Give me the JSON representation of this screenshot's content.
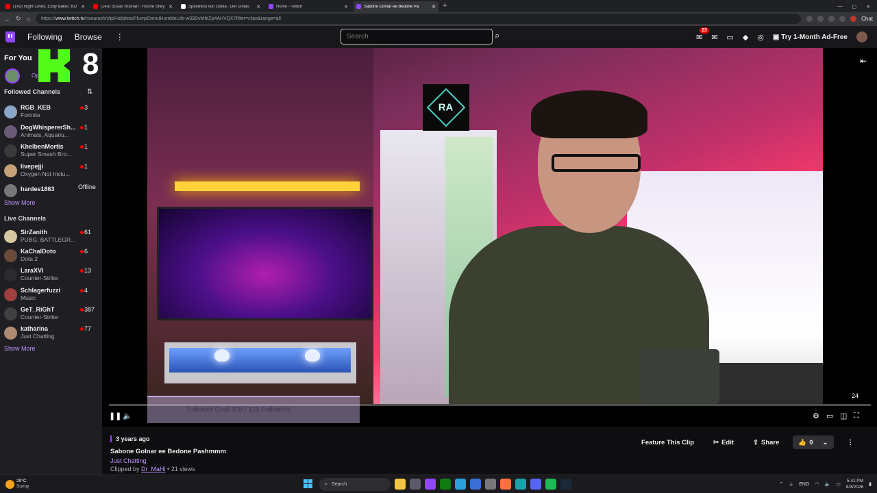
{
  "browser": {
    "tabs": [
      {
        "title": "(143) Night Lovell, Eddy Baker, BO",
        "favcolor": "#ff0000",
        "active": false
      },
      {
        "title": "(143) Susan Roshan - Roohe Shey",
        "favcolor": "#ff0000",
        "active": false
      },
      {
        "title": "Speedtest von Ookla - Der umfas",
        "favcolor": "#ffffff",
        "active": false
      },
      {
        "title": "Home - Twitch",
        "favcolor": "#9147ff",
        "active": false
      },
      {
        "title": "Sabone Golnar ee Bedone Pa",
        "favcolor": "#9147ff",
        "active": true
      }
    ],
    "url_prefix": "https://",
    "url_host": "www.twitch.tv",
    "url_path": "/risearash/clip/HelplessPlumpDonutHumbleLife-w39DvMfeZp4AHVQK?filter=clips&range=all",
    "chat_label": "Chat"
  },
  "topnav": {
    "following": "Following",
    "browse": "Browse",
    "search_placeholder": "Search",
    "notif_count": "23",
    "adfree": "Try 1-Month Ad-Free"
  },
  "sidebar": {
    "for_you": "For You",
    "for_you_sub": "Op",
    "overlay_number": "8",
    "followed_heading": "Followed Channels",
    "followed": [
      {
        "name": "RGB_KEB",
        "game": "Fortnite",
        "viewers": "3",
        "color": "#8aa6c8"
      },
      {
        "name": "DogWhispererSh...",
        "game": "Animals, Aquariu...",
        "viewers": "1",
        "color": "#6a5a7a"
      },
      {
        "name": "KhelbenMortis",
        "game": "Super Smash Bro...",
        "viewers": "1",
        "color": "#3a3a3a"
      },
      {
        "name": "livepejji",
        "game": "Oxygen Not Inclu...",
        "viewers": "1",
        "color": "#c8a078"
      }
    ],
    "offline_channel": {
      "name": "hardee1863",
      "status": "Offline",
      "color": "#777"
    },
    "show_more": "Show More",
    "live_heading": "Live Channels",
    "live": [
      {
        "name": "SirZanith",
        "game": "PUBG: BATTLEGR...",
        "viewers": "61",
        "color": "#d8c8a0"
      },
      {
        "name": "KaChalDoto",
        "game": "Dota 2",
        "viewers": "6",
        "color": "#6b4a3a"
      },
      {
        "name": "LaraXVI",
        "game": "Counter-Strike",
        "viewers": "13",
        "color": "#2a2a30"
      },
      {
        "name": "Schlagerfuzzi",
        "game": "Music",
        "viewers": "4",
        "color": "#a04040"
      },
      {
        "name": "GeT_RiGhT",
        "game": "Counter-Strike",
        "viewers": "387",
        "color": "#404040"
      },
      {
        "name": "katharina",
        "game": "Just Chatting",
        "viewers": "77",
        "color": "#b08a70"
      }
    ],
    "show_more_live": "Show More"
  },
  "player": {
    "logo_text": "RA",
    "overlay_text": "Follower Goal          108 / 110 Followers",
    "time_remaining": "24",
    "progress": 0.0
  },
  "clip": {
    "age": "3 years ago",
    "title": "Sabone Golnar ee Bedone Pashmmm",
    "category": "Just Chatting",
    "clipped_by_label": "Clipped by ",
    "clipper": "Dr_MaHi",
    "views": " • 21 views",
    "feature_label": "Feature This Clip",
    "edit_label": "Edit",
    "share_label": "Share",
    "likes": "0"
  },
  "taskbar": {
    "temp": "29°C",
    "condition": "Sunny",
    "search": "Search",
    "lang": "ENG",
    "time": "5:41 PM",
    "date": "8/3/2026"
  }
}
